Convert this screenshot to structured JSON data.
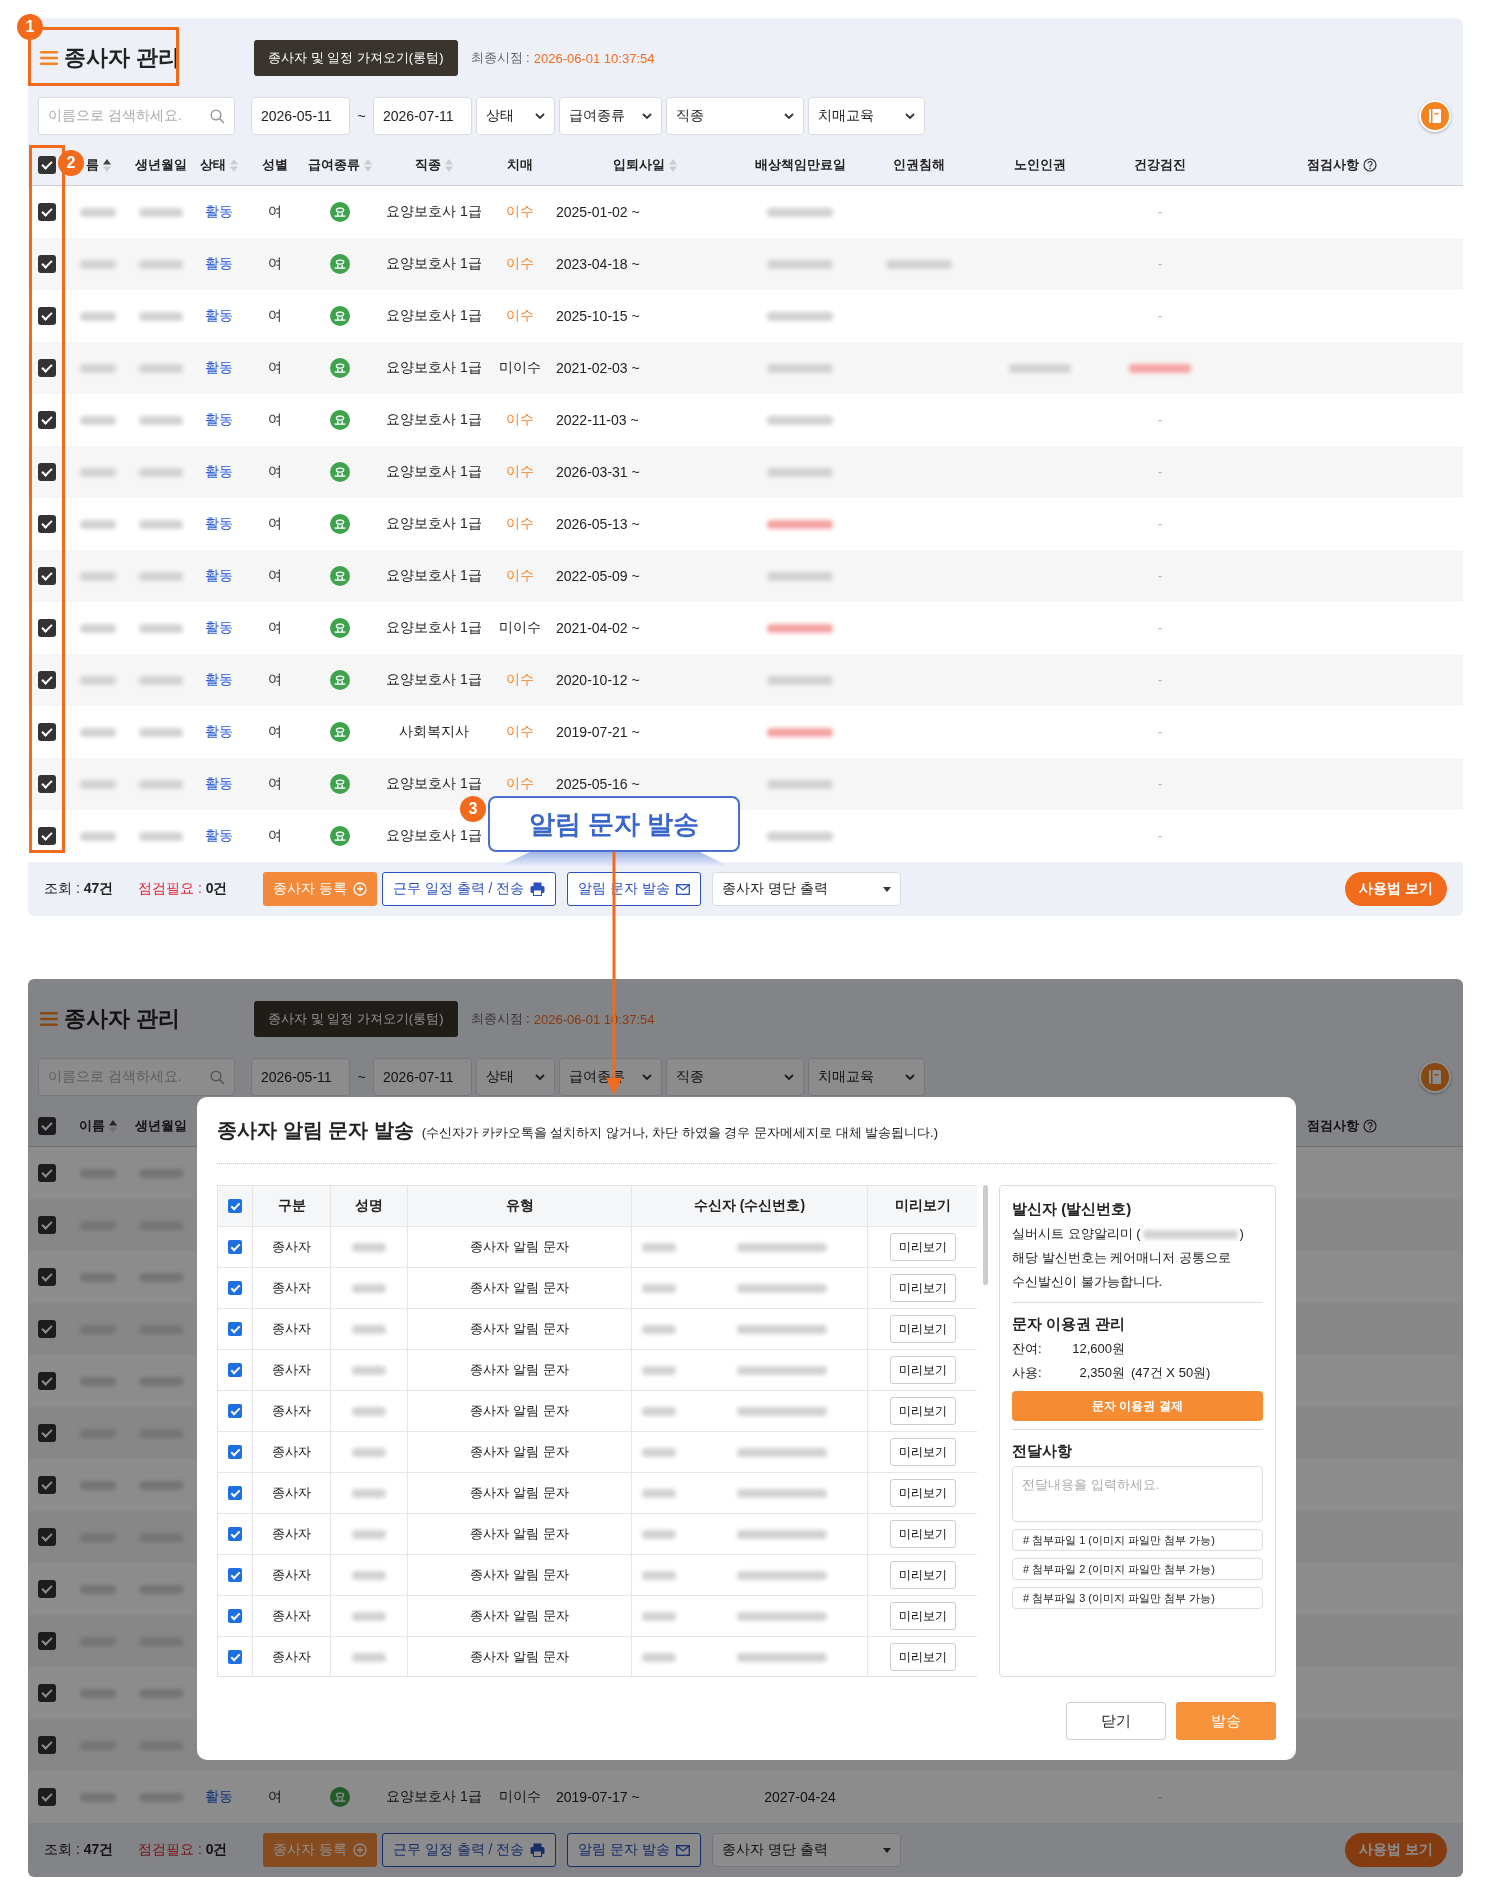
{
  "screens": [
    {
      "dimmed": false,
      "title": "종사자 관리",
      "import_button": "종사자 및 일정 가져오기(롱텀)",
      "last_sync_label": "최종시점 :",
      "last_sync_value": "2026-06-01 10:37:54",
      "filters": {
        "search_placeholder": "이름으로 검색하세요.",
        "date_from": "2026-05-11",
        "date_sep": "~",
        "date_to": "2026-07-11",
        "selects": [
          "상태",
          "급여종류",
          "직종",
          "치매교육"
        ]
      },
      "header_checked": true,
      "columns": [
        {
          "label": "름",
          "sortable": true,
          "sorted": true
        },
        {
          "label": "생년월일"
        },
        {
          "label": "상태",
          "sortable": true,
          "sorted": false
        },
        {
          "label": "성별"
        },
        {
          "label": "급여종류",
          "sortable": true,
          "sorted": false
        },
        {
          "label": "직종",
          "sortable": true,
          "sorted": false
        },
        {
          "label": "치매"
        },
        {
          "label": "입퇴사일",
          "sortable": true,
          "sorted": false
        },
        {
          "label": "배상책임만료일"
        },
        {
          "label": "인권침해"
        },
        {
          "label": "노인인권"
        },
        {
          "label": "건강검진"
        }
      ],
      "notes_column": {
        "label": "점검사항",
        "help": true
      },
      "rows": [
        {
          "checked": true,
          "status": "활동",
          "gender": "여",
          "pay": "요",
          "job": "요양보호사 1급",
          "edu": "이수",
          "edu_done": true,
          "period": "2025-01-02 ~",
          "health": "-",
          "masked": {
            "name": true,
            "birth": true,
            "liability": true
          }
        },
        {
          "checked": true,
          "status": "활동",
          "gender": "여",
          "pay": "요",
          "job": "요양보호사 1급",
          "edu": "이수",
          "edu_done": true,
          "period": "2023-04-18 ~",
          "health": "-",
          "masked": {
            "name": true,
            "birth": true,
            "liability": true,
            "human_rights": true
          }
        },
        {
          "checked": true,
          "status": "활동",
          "gender": "여",
          "pay": "요",
          "job": "요양보호사 1급",
          "edu": "이수",
          "edu_done": true,
          "period": "2025-10-15 ~",
          "health": "-",
          "masked": {
            "name": true,
            "birth": true,
            "liability": true
          }
        },
        {
          "checked": true,
          "status": "활동",
          "gender": "여",
          "pay": "요",
          "job": "요양보호사 1급",
          "edu": "미이수",
          "edu_done": false,
          "period": "2021-02-03 ~",
          "masked": {
            "name": true,
            "birth": true,
            "liability": true,
            "elder_rights": true,
            "health": true
          },
          "masked_alert": {
            "health": true
          }
        },
        {
          "checked": true,
          "status": "활동",
          "gender": "여",
          "pay": "요",
          "job": "요양보호사 1급",
          "edu": "이수",
          "edu_done": true,
          "period": "2022-11-03 ~",
          "health": "-",
          "masked": {
            "name": true,
            "birth": true,
            "liability": true
          }
        },
        {
          "checked": true,
          "status": "활동",
          "gender": "여",
          "pay": "요",
          "job": "요양보호사 1급",
          "edu": "이수",
          "edu_done": true,
          "period": "2026-03-31 ~",
          "health": "-",
          "masked": {
            "name": true,
            "birth": true,
            "liability": true
          }
        },
        {
          "checked": true,
          "status": "활동",
          "gender": "여",
          "pay": "요",
          "job": "요양보호사 1급",
          "edu": "이수",
          "edu_done": true,
          "period": "2026-05-13 ~",
          "health": "-",
          "masked": {
            "name": true,
            "birth": true,
            "liability": true
          },
          "masked_alert": {
            "liability": true
          }
        },
        {
          "checked": true,
          "status": "활동",
          "gender": "여",
          "pay": "요",
          "job": "요양보호사 1급",
          "edu": "이수",
          "edu_done": true,
          "period": "2022-05-09 ~",
          "health": "-",
          "masked": {
            "name": true,
            "birth": true,
            "liability": true
          }
        },
        {
          "checked": true,
          "status": "활동",
          "gender": "여",
          "pay": "요",
          "job": "요양보호사 1급",
          "edu": "미이수",
          "edu_done": false,
          "period": "2021-04-02 ~",
          "health": "-",
          "masked": {
            "name": true,
            "birth": true,
            "liability": true
          },
          "masked_alert": {
            "liability": true
          }
        },
        {
          "checked": true,
          "status": "활동",
          "gender": "여",
          "pay": "요",
          "job": "요양보호사 1급",
          "edu": "이수",
          "edu_done": true,
          "period": "2020-10-12 ~",
          "health": "-",
          "masked": {
            "name": true,
            "birth": true,
            "liability": true
          }
        },
        {
          "checked": true,
          "status": "활동",
          "gender": "여",
          "pay": "요",
          "job": "사회복지사",
          "edu": "이수",
          "edu_done": true,
          "period": "2019-07-21 ~",
          "health": "-",
          "masked": {
            "name": true,
            "birth": true,
            "liability": true
          },
          "masked_alert": {
            "liability": true
          }
        },
        {
          "checked": true,
          "status": "활동",
          "gender": "여",
          "pay": "요",
          "job": "요양보호사 1급",
          "edu": "이수",
          "edu_done": true,
          "period": "2025-05-16 ~",
          "health": "-",
          "masked": {
            "name": true,
            "birth": true,
            "liability": true
          }
        },
        {
          "checked": true,
          "status": "활동",
          "gender": "여",
          "pay": "요",
          "job": "요양보호사 1급",
          "health": "-",
          "masked": {
            "name": true,
            "birth": true,
            "liability": true
          }
        }
      ],
      "footer": {
        "count": "조회 : **47건**",
        "needs_check": "점검필요 : **0건**",
        "register_button": "종사자 등록",
        "schedule_button": "근무 일정 출력 / 전송",
        "sms_button": "알림 문자 발송",
        "export_select": "종사자 명단 출력",
        "guide_button": "사용법 보기"
      }
    },
    {
      "dimmed": true,
      "title": "종사자 관리",
      "import_button": "종사자 및 일정 가져오기(롱텀)",
      "last_sync_label": "최종시점 :",
      "last_sync_value": "2026-06-01 10:37:54",
      "filters": {
        "search_placeholder": "이름으로 검색하세요.",
        "date_from": "2026-05-11",
        "date_sep": "~",
        "date_to": "2026-07-11",
        "selects": [
          "상태",
          "급여종류",
          "직종",
          "치매교육"
        ]
      },
      "header_checked": true,
      "columns": [
        {
          "label": "이름",
          "sortable": true,
          "sorted": true
        },
        {
          "label": "생년월일"
        }
      ],
      "notes_column": {
        "label": "점검사항",
        "help": true
      },
      "rows": [
        {
          "checked": true,
          "masked": {
            "name": true,
            "birth": true
          }
        },
        {
          "checked": true,
          "masked": {
            "name": true,
            "birth": true
          }
        },
        {
          "checked": true,
          "masked": {
            "name": true,
            "birth": true
          }
        },
        {
          "checked": true,
          "masked": {
            "name": true,
            "birth": true
          }
        },
        {
          "checked": true,
          "masked": {
            "name": true,
            "birth": true
          }
        },
        {
          "checked": true,
          "masked": {
            "name": true,
            "birth": true
          }
        },
        {
          "checked": true,
          "masked": {
            "name": true,
            "birth": true
          }
        },
        {
          "checked": true,
          "masked": {
            "name": true,
            "birth": true
          }
        },
        {
          "checked": true,
          "masked": {
            "name": true,
            "birth": true
          }
        },
        {
          "checked": true,
          "masked": {
            "name": true,
            "birth": true
          }
        },
        {
          "checked": true,
          "masked": {
            "name": true,
            "birth": true
          }
        },
        {
          "checked": true,
          "masked": {
            "name": true,
            "birth": true
          }
        },
        {
          "checked": true,
          "status": "활동",
          "gender": "여",
          "pay": "요",
          "job": "요양보호사 1급",
          "edu": "미이수",
          "edu_done": false,
          "period": "2019-07-17 ~",
          "liability": "2027-04-24",
          "health": "-",
          "masked": {
            "name": true,
            "birth": true
          }
        }
      ],
      "footer": {
        "count": "조회 : **47건**",
        "needs_check": "점검필요 : **0건**",
        "register_button": "종사자 등록",
        "schedule_button": "근무 일정 출력 / 전송",
        "sms_button": "알림 문자 발송",
        "export_select": "종사자 명단 출력",
        "guide_button": "사용법 보기"
      }
    }
  ],
  "annotations": {
    "markers": [
      "1",
      "2",
      "3"
    ],
    "callout": "알림 문자 발송"
  },
  "modal": {
    "title": "종사자 알림 문자 발송",
    "note": "(수신자가 카카오톡을 설치하지 않거나, 차단 하였을 경우 문자메세지로 대체 발송됩니다.)",
    "all_checked": true,
    "columns": [
      "구분",
      "성명",
      "유형",
      "수신자 (수신번호)",
      "미리보기"
    ],
    "rows": [
      {
        "checked": true,
        "category": "종사자",
        "type": "종사자 알림 문자",
        "preview": "미리보기"
      },
      {
        "checked": true,
        "category": "종사자",
        "type": "종사자 알림 문자",
        "preview": "미리보기"
      },
      {
        "checked": true,
        "category": "종사자",
        "type": "종사자 알림 문자",
        "preview": "미리보기"
      },
      {
        "checked": true,
        "category": "종사자",
        "type": "종사자 알림 문자",
        "preview": "미리보기"
      },
      {
        "checked": true,
        "category": "종사자",
        "type": "종사자 알림 문자",
        "preview": "미리보기"
      },
      {
        "checked": true,
        "category": "종사자",
        "type": "종사자 알림 문자",
        "preview": "미리보기"
      },
      {
        "checked": true,
        "category": "종사자",
        "type": "종사자 알림 문자",
        "preview": "미리보기"
      },
      {
        "checked": true,
        "category": "종사자",
        "type": "종사자 알림 문자",
        "preview": "미리보기"
      },
      {
        "checked": true,
        "category": "종사자",
        "type": "종사자 알림 문자",
        "preview": "미리보기"
      },
      {
        "checked": true,
        "category": "종사자",
        "type": "종사자 알림 문자",
        "preview": "미리보기"
      },
      {
        "checked": true,
        "category": "종사자",
        "type": "종사자 알림 문자",
        "preview": "미리보기"
      }
    ],
    "sender": {
      "heading": "발신자 (발신번호)",
      "line_start": "실버시트 요양알리미 (",
      "line_end": ")",
      "note": "해당 발신번호는 케어매니저 공통으로\n수신발신이 불가능합니다."
    },
    "ticket": {
      "heading": "문자 이용권 관리",
      "rows": [
        {
          "label": "잔여:",
          "amount": "12,600원"
        },
        {
          "label": "사용:",
          "amount": "2,350원",
          "detail": "(47건 X 50원)"
        }
      ],
      "pay_button": "문자 이용권 결제"
    },
    "message": {
      "heading": "전달사항",
      "placeholder": "전달내용을 입력하세요.",
      "attachments": [
        "# 첨부파일 1 (이미지 파일만 첨부 가능)",
        "# 첨부파일 2 (이미지 파일만 첨부 가능)",
        "# 첨부파일 3 (이미지 파일만 첨부 가능)"
      ]
    },
    "buttons": [
      {
        "label": "닫기",
        "kind": "secondary"
      },
      {
        "label": "발송",
        "kind": "primary"
      }
    ]
  }
}
